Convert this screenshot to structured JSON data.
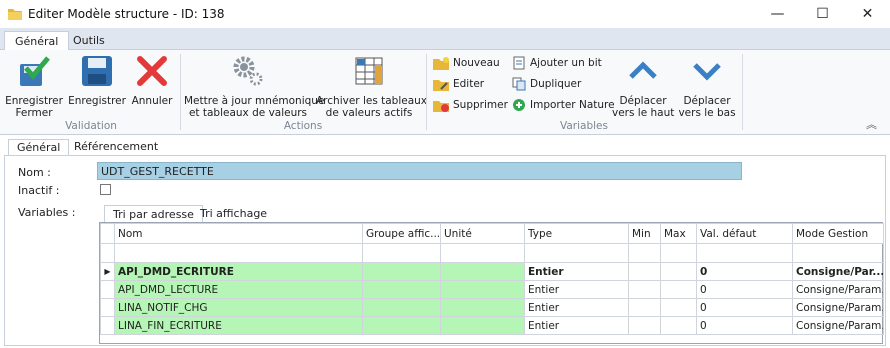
{
  "window": {
    "title": "Editer Modèle structure - ID: 138",
    "minimize_glyph": "—",
    "maximize_glyph": "☐",
    "close_glyph": "✕"
  },
  "ribbon": {
    "tabs": [
      "Général",
      "Outils"
    ],
    "groups": {
      "validation": {
        "label": "Validation",
        "buttons": [
          {
            "label1": "Enregistrer",
            "label2": "Fermer",
            "icon": "save-close-icon"
          },
          {
            "label1": "Enregistrer",
            "label2": "",
            "icon": "floppy-icon"
          },
          {
            "label1": "Annuler",
            "label2": "",
            "icon": "cancel-x-icon"
          }
        ]
      },
      "actions": {
        "label": "Actions",
        "buttons": [
          {
            "label1": "Mettre à jour mnémonique",
            "label2": "et tableaux de valeurs",
            "icon": "gears-icon"
          },
          {
            "label1": "Archiver les tableaux",
            "label2": "de valeurs actifs",
            "icon": "archive-grid-icon"
          }
        ]
      },
      "variables": {
        "label": "Variables",
        "small_buttons_col1": [
          "Nouveau",
          "Editer",
          "Supprimer"
        ],
        "small_buttons_col2": [
          "Ajouter un bit",
          "Dupliquer",
          "Importer Nature"
        ],
        "move_up": {
          "label1": "Déplacer",
          "label2": "vers le haut"
        },
        "move_down": {
          "label1": "Déplacer",
          "label2": "vers le bas"
        }
      }
    },
    "collapse_glyph": "︽"
  },
  "form": {
    "tabs": [
      "Général",
      "Référencement"
    ],
    "nom_label": "Nom :",
    "nom_value": "UDT_GEST_RECETTE",
    "inactif_label": "Inactif :",
    "variables_label": "Variables :",
    "grid_tabs": [
      "Tri par adresse",
      "Tri affichage"
    ],
    "columns": [
      "Nom",
      "Groupe affic...",
      "Unité",
      "Type",
      "Min",
      "Max",
      "Val. défaut",
      "Mode Gestion"
    ],
    "current_row_marker": "▶",
    "rows": [
      {
        "nom": "API_DMD_ECRITURE",
        "groupe": "",
        "unite": "",
        "type": "Entier",
        "min": "",
        "max": "",
        "defaut": "0",
        "mode": "Consigne/Par..."
      },
      {
        "nom": "API_DMD_LECTURE",
        "groupe": "",
        "unite": "",
        "type": "Entier",
        "min": "",
        "max": "",
        "defaut": "0",
        "mode": "Consigne/Param..."
      },
      {
        "nom": "LINA_NOTIF_CHG",
        "groupe": "",
        "unite": "",
        "type": "Entier",
        "min": "",
        "max": "",
        "defaut": "0",
        "mode": "Consigne/Param..."
      },
      {
        "nom": "LINA_FIN_ECRITURE",
        "groupe": "",
        "unite": "",
        "type": "Entier",
        "min": "",
        "max": "",
        "defaut": "0",
        "mode": "Consigne/Param..."
      }
    ]
  },
  "colors": {
    "nom_field": "#a7d0e4",
    "green_cells": "#b5f5b5",
    "ribbon_tab_bg": "#dfe6ef"
  }
}
